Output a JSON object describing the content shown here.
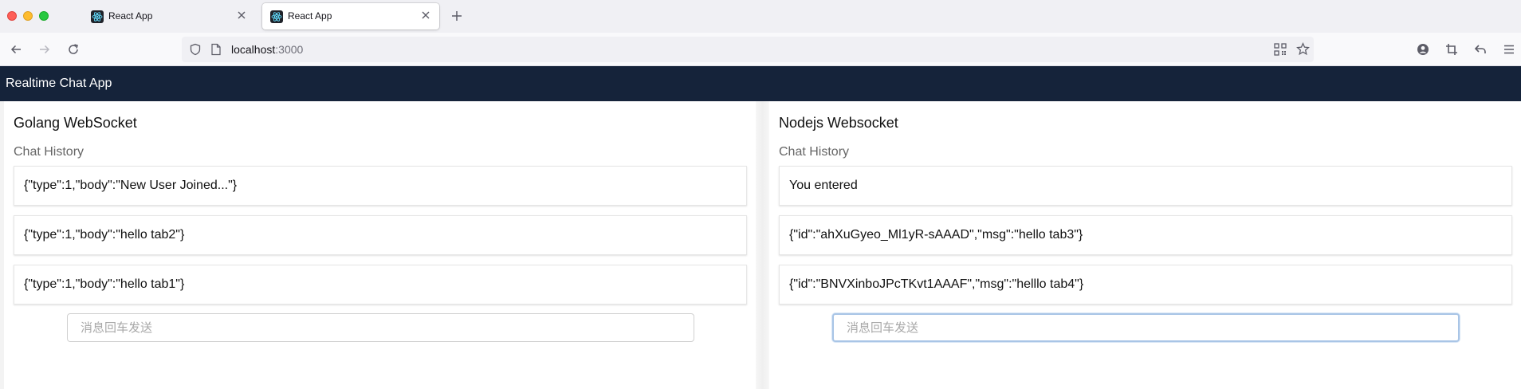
{
  "browser": {
    "tabs": [
      {
        "title": "React App",
        "active": false
      },
      {
        "title": "React App",
        "active": true
      }
    ],
    "url_host": "localhost",
    "url_port": ":3000",
    "icons": [
      "back-icon",
      "forward-icon",
      "reload-icon",
      "shield-icon",
      "page-icon",
      "qr-code-icon",
      "star-icon",
      "account-icon",
      "screenshot-icon",
      "undo-icon",
      "menu-icon"
    ]
  },
  "app": {
    "title": "Realtime Chat App",
    "header_color": "#15233a"
  },
  "panels": {
    "golang": {
      "title": "Golang WebSocket",
      "history_label": "Chat History",
      "messages": [
        "{\"type\":1,\"body\":\"New User Joined...\"}",
        "{\"type\":1,\"body\":\"hello tab2\"}",
        "{\"type\":1,\"body\":\"hello tab1\"}"
      ],
      "input_placeholder": "消息回车发送",
      "input_value": ""
    },
    "nodejs": {
      "title": "Nodejs Websocket",
      "history_label": "Chat History",
      "messages": [
        "You entered",
        "{\"id\":\"ahXuGyeo_Ml1yR-sAAAD\",\"msg\":\"hello tab3\"}",
        "{\"id\":\"BNVXinboJPcTKvt1AAAF\",\"msg\":\"helllo tab4\"}"
      ],
      "input_placeholder": "消息回车发送",
      "input_value": ""
    }
  }
}
